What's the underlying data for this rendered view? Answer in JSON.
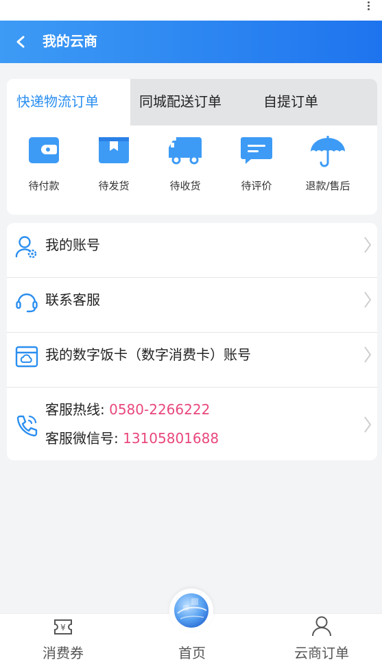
{
  "header": {
    "title": "我的云商"
  },
  "order_tabs": [
    {
      "label": "快递物流订单",
      "active": true
    },
    {
      "label": "同城配送订单",
      "active": false
    },
    {
      "label": "自提订单",
      "active": false
    }
  ],
  "order_status": [
    {
      "label": "待付款",
      "icon": "wallet-icon"
    },
    {
      "label": "待发货",
      "icon": "package-icon"
    },
    {
      "label": "待收货",
      "icon": "truck-icon"
    },
    {
      "label": "待评价",
      "icon": "comment-icon"
    },
    {
      "label": "退款/售后",
      "icon": "umbrella-icon"
    }
  ],
  "menu": {
    "account": {
      "label": "我的账号",
      "icon": "user-settings-icon"
    },
    "service": {
      "label": "联系客服",
      "icon": "headset-icon"
    },
    "meal_card": {
      "label": "我的数字饭卡（数字消费卡）账号",
      "icon": "card-icon"
    },
    "hotline": {
      "icon": "phone-icon",
      "hotline_label": "客服热线:",
      "hotline_value": "0580-2266222",
      "wechat_label": "客服微信号:",
      "wechat_value": "13105801688"
    }
  },
  "bottom_tabs": [
    {
      "label": "消费券",
      "icon": "coupon-icon"
    },
    {
      "label": "首页",
      "icon": "globe-icon"
    },
    {
      "label": "云商订单",
      "icon": "person-icon"
    }
  ],
  "colors": {
    "accent": "#2a8ef0",
    "header_start": "#3d9bf5",
    "header_end": "#1e74ee",
    "highlight": "#e8477a"
  }
}
